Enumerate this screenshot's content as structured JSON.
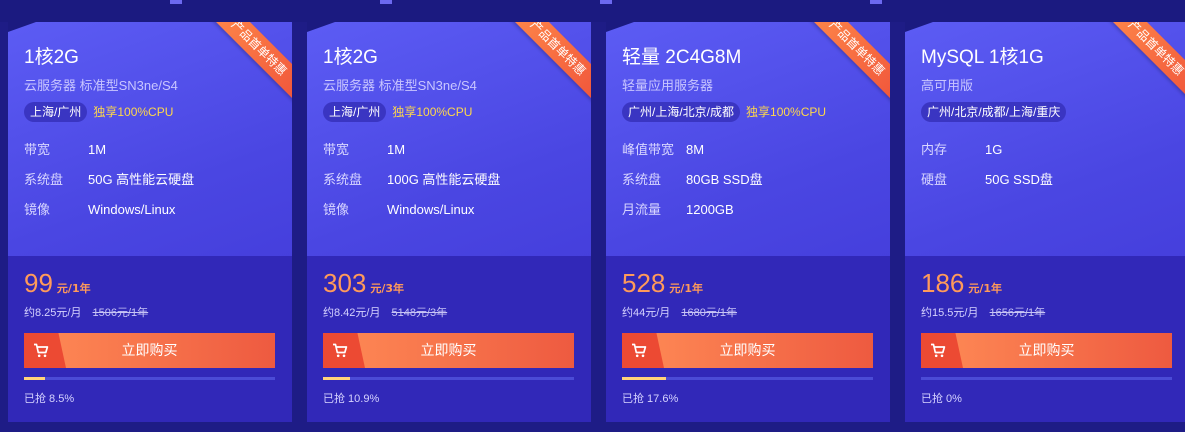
{
  "cards": [
    {
      "ribbon": "产品首单特惠",
      "title": "1核2G",
      "subtitle": "云服务器 标准型SN3ne/S4",
      "tags": [
        "上海/广州",
        "独享100%CPU"
      ],
      "specs": [
        {
          "k": "带宽",
          "v": "1M"
        },
        {
          "k": "系统盘",
          "v": "50G 高性能云硬盘"
        },
        {
          "k": "镜像",
          "v": "Windows/Linux"
        }
      ],
      "price": "99",
      "unit": "元/1年",
      "monthly": "约8.25元/月",
      "original": "1506元/1年",
      "buy_label": "立即购买",
      "progress": 8.5,
      "sold_text": "已抢 8.5%"
    },
    {
      "ribbon": "产品首单特惠",
      "title": "1核2G",
      "subtitle": "云服务器 标准型SN3ne/S4",
      "tags": [
        "上海/广州",
        "独享100%CPU"
      ],
      "specs": [
        {
          "k": "带宽",
          "v": "1M"
        },
        {
          "k": "系统盘",
          "v": "100G 高性能云硬盘"
        },
        {
          "k": "镜像",
          "v": "Windows/Linux"
        }
      ],
      "price": "303",
      "unit": "元/3年",
      "monthly": "约8.42元/月",
      "original": "5148元/3年",
      "buy_label": "立即购买",
      "progress": 10.9,
      "sold_text": "已抢 10.9%"
    },
    {
      "ribbon": "产品首单特惠",
      "title": "轻量 2C4G8M",
      "subtitle": "轻量应用服务器",
      "tags": [
        "广州/上海/北京/成都",
        "独享100%CPU"
      ],
      "specs": [
        {
          "k": "峰值带宽",
          "v": "8M"
        },
        {
          "k": "系统盘",
          "v": "80GB SSD盘"
        },
        {
          "k": "月流量",
          "v": "1200GB"
        }
      ],
      "price": "528",
      "unit": "元/1年",
      "monthly": "约44元/月",
      "original": "1680元/1年",
      "buy_label": "立即购买",
      "progress": 17.6,
      "sold_text": "已抢 17.6%"
    },
    {
      "ribbon": "产品首单特惠",
      "title": "MySQL 1核1G",
      "subtitle": "高可用版",
      "tags": [
        "广州/北京/成都/上海/重庆"
      ],
      "specs": [
        {
          "k": "内存",
          "v": "1G"
        },
        {
          "k": "硬盘",
          "v": "50G SSD盘"
        }
      ],
      "price": "186",
      "unit": "元/1年",
      "monthly": "约15.5元/月",
      "original": "1656元/1年",
      "buy_label": "立即购买",
      "progress": 0,
      "sold_text": "已抢 0%"
    }
  ],
  "colors": {
    "page_bg": "#1e1c86",
    "card_top": "#5c5cf4",
    "card_bottom": "#3128b8",
    "price": "#ff9a5a",
    "cpu_tag": "#ffd84a",
    "button_start": "#ff8c56",
    "button_end": "#ee5a40",
    "progress_fill": "#ffd37a"
  },
  "icons": {
    "cart": "cart-icon"
  }
}
